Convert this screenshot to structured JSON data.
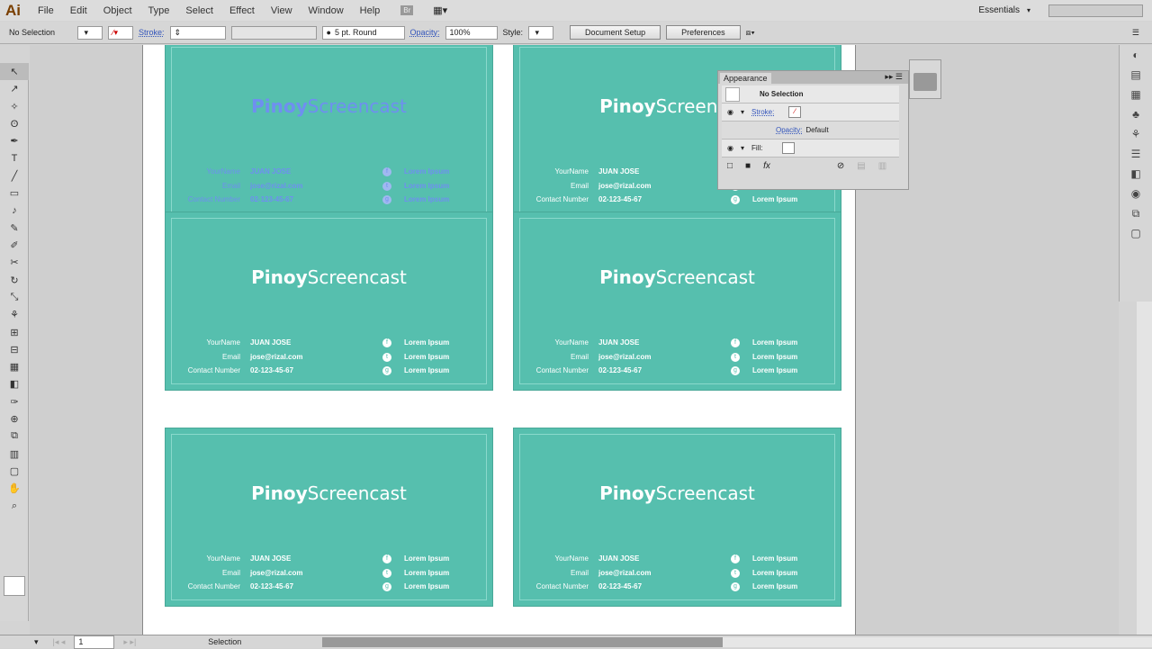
{
  "app": {
    "logo": "Ai",
    "menus": [
      "File",
      "Edit",
      "Object",
      "Type",
      "Select",
      "Effect",
      "View",
      "Window",
      "Help"
    ],
    "workspace": "Essentials",
    "search_placeholder": ""
  },
  "control": {
    "selection": "No Selection",
    "stroke_label": "Stroke:",
    "brush": "5 pt. Round",
    "opacity_label": "Opacity:",
    "opacity": "100%",
    "style_label": "Style:",
    "document_setup": "Document Setup",
    "preferences": "Preferences"
  },
  "tools": [
    "↖",
    "↗",
    "✧",
    "ʘ",
    "✒",
    "T",
    "╱",
    "▭",
    "♪",
    "✎",
    "✐",
    "✂",
    "↻",
    "⤡",
    "⚘",
    "⊞",
    "⊟",
    "▦",
    "◧",
    "✑",
    "⊕",
    "⧉",
    "▥",
    "▢",
    "✋",
    "⌕"
  ],
  "cards": [
    {
      "brand_bold": "Pinoy",
      "brand_light": "Screencast",
      "rows": [
        {
          "label": "YourName",
          "value": "JUAN JOSE",
          "icon": "f",
          "social": "Lorem Ipsum"
        },
        {
          "label": "Email",
          "value": "jose@rizal.com",
          "icon": "t",
          "social": "Lorem Ipsum"
        },
        {
          "label": "Contact Number",
          "value": "02-123-45-67",
          "icon": "g",
          "social": "Lorem Ipsum"
        }
      ]
    }
  ],
  "appearance": {
    "tab": "Appearance",
    "header": "No Selection",
    "stroke": "Stroke:",
    "opacity_label": "Opacity:",
    "opacity_value": "Default",
    "fill": "Fill:"
  },
  "status": {
    "artboard": "1",
    "tool": "Selection"
  },
  "colors": {
    "card": "#56bfae",
    "accent_blue": "#3355bb"
  }
}
